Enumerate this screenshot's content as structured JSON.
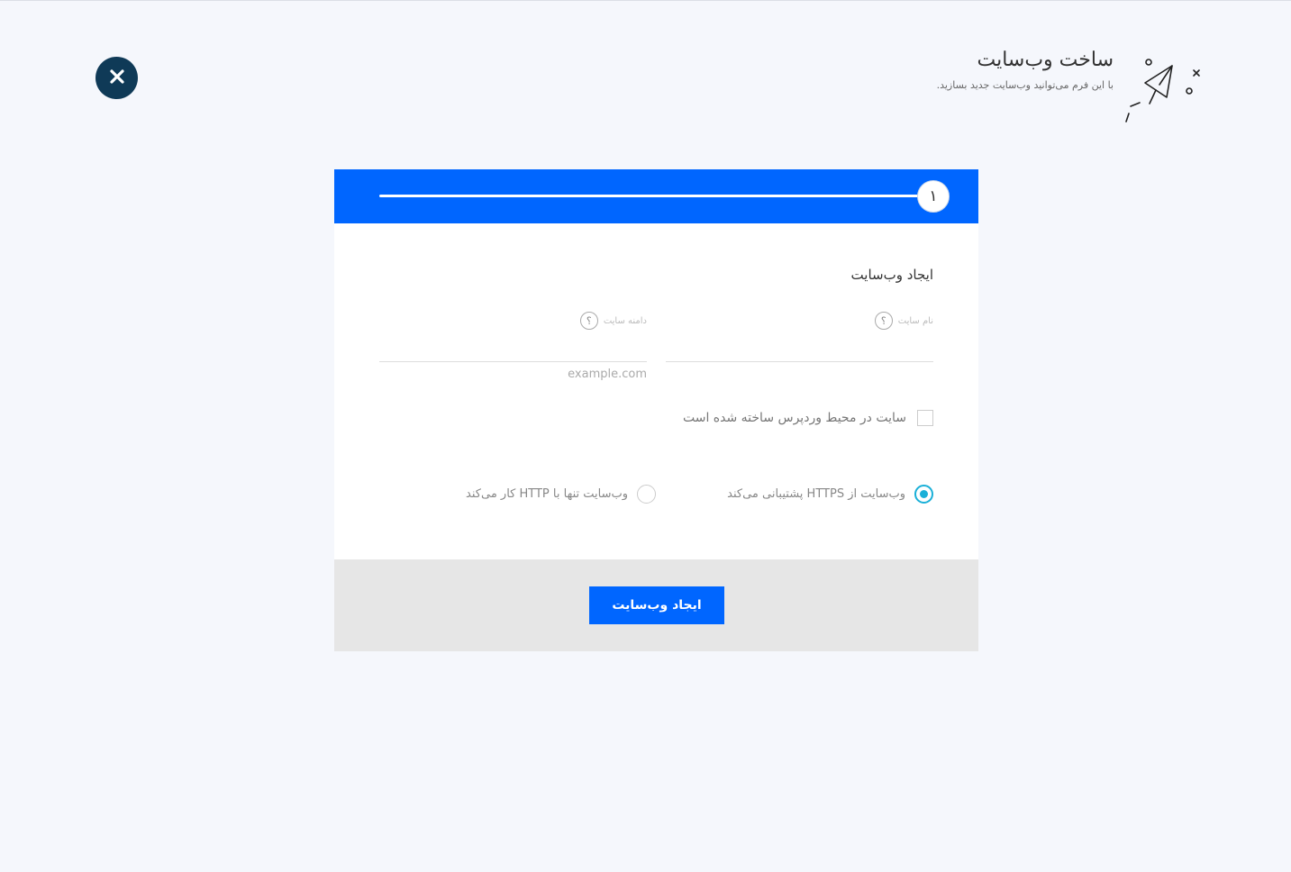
{
  "header": {
    "title": "ساخت وب‌سایت",
    "subtitle": "با این فرم می‌توانید وب‌سایت جدید بسازید."
  },
  "icons": {
    "close": "close-icon",
    "plane": "paper-plane-icon",
    "help": "question-icon"
  },
  "stepper": {
    "current_step": "۱",
    "progress": 1
  },
  "form": {
    "title": "ایجاد وب‌سایت",
    "site_name": {
      "label": "نام سایت",
      "value": "",
      "help": "؟"
    },
    "site_domain": {
      "label": "دامنه سایت",
      "value": "",
      "hint": "example.com",
      "help": "؟"
    },
    "wordpress": {
      "label": "سایت در محیط وردپرس ساخته شده است",
      "checked": false
    },
    "protocol": {
      "options": [
        {
          "label": "وب‌سایت از HTTPS پشتیبانی می‌کند",
          "selected": true
        },
        {
          "label": "وب‌سایت تنها با HTTP کار می‌کند",
          "selected": false
        }
      ]
    }
  },
  "footer": {
    "submit_label": "ایجاد وب‌سایت"
  },
  "colors": {
    "primary": "#0066ff",
    "close_bg": "#0f3a57",
    "radio_active": "#1ab0d8",
    "footer_bg": "#e6e6e6",
    "page_bg": "#f5f7fc"
  }
}
